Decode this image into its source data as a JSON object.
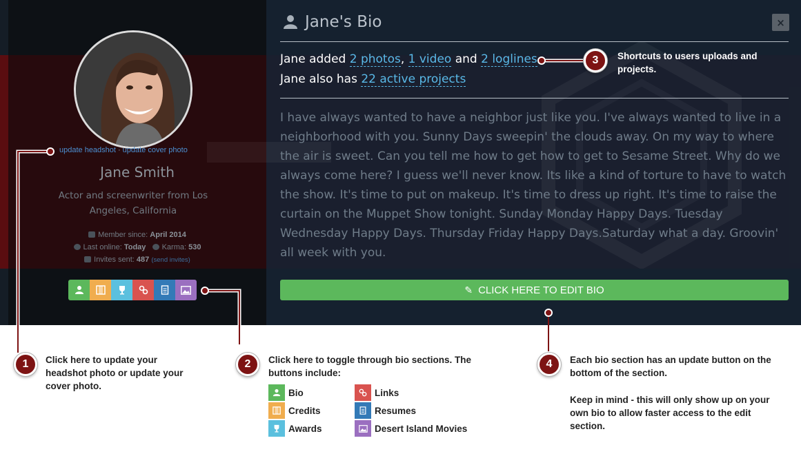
{
  "colors": {
    "bio": "#5cb85c",
    "credits": "#f0ad4e",
    "awards": "#5bc0de",
    "links": "#d9534f",
    "resumes": "#337ab7",
    "movies": "#9b6fc0",
    "badge": "#7d1313",
    "link": "#59b9e8"
  },
  "profile": {
    "update_headshot": "update headshot",
    "separator": "·",
    "update_cover": "update cover photo",
    "name": "Jane Smith",
    "tagline": "Actor and screenwriter from Los Angeles, California",
    "member_label": "Member since:",
    "member_value": "April 2014",
    "online_label": "Last online:",
    "online_value": "Today",
    "karma_label": "Karma:",
    "karma_value": "530",
    "invites_label": "Invites sent:",
    "invites_value": "487",
    "send_invites": "(send invites)"
  },
  "bio": {
    "title": "Jane's Bio",
    "close": "×",
    "added_prefix": "Jane added",
    "photos": "2 photos",
    "comma": ",",
    "video": "1 video",
    "and": "and",
    "loglines": "2 loglines",
    "also_prefix": "Jane also has",
    "projects": "22 active projects",
    "text": "I have always wanted to have a neighbor just like you. I've always wanted to live in a neighborhood with you. Sunny Days sweepin' the clouds away. On my way to where the air is sweet. Can you tell me how to get how to get to Sesame Street. Why do we always come here? I guess we'll never know. Its like a kind of torture to have to watch the show. It's time to put on makeup. It's time to dress up right. It's time to raise the curtain on the Muppet Show tonight. Sunday Monday Happy Days. Tuesday Wednesday Happy Days. Thursday Friday Happy Days.Saturday what a day. Groovin' all week with you.",
    "edit_button": "CLICK HERE TO EDIT BIO"
  },
  "callouts": {
    "c1_num": "1",
    "c1_text": "Click here to update your headshot photo or update your cover photo.",
    "c2_num": "2",
    "c2_text": "Click here to toggle through bio sections. The buttons include:",
    "c3_num": "3",
    "c3_text": "Shortcuts to users uploads and projects.",
    "c4_num": "4",
    "c4_text_1": "Each bio section has an update button on the bottom of the section.",
    "c4_text_2": "Keep in mind - this will only show up on your own bio to allow faster access to the edit section."
  },
  "sections": [
    "Bio",
    "Credits",
    "Awards",
    "Links",
    "Resumes",
    "Desert Island Movies"
  ]
}
